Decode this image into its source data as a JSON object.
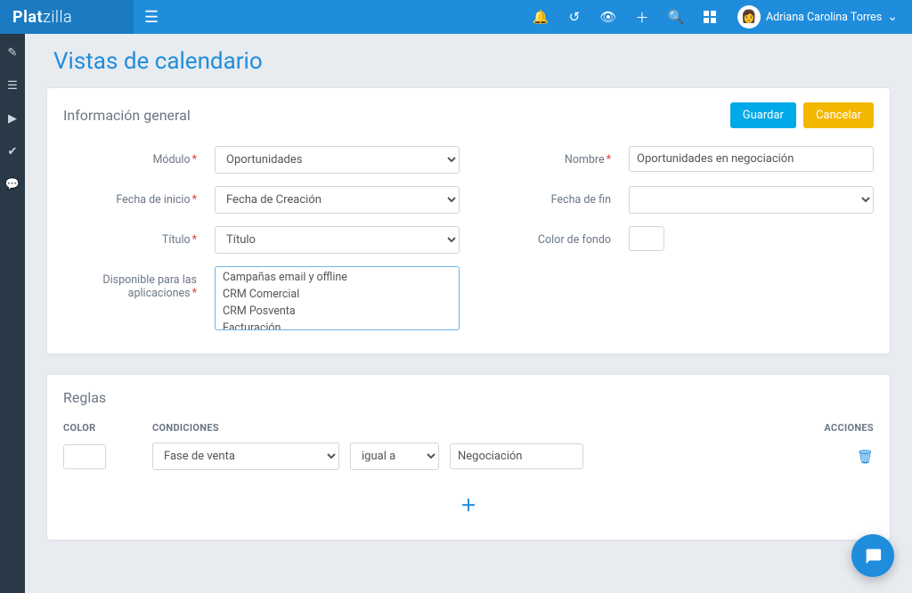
{
  "brand": {
    "a": "Plat",
    "b": "zilla"
  },
  "user": {
    "name": "Adriana Carolina Torres"
  },
  "page": {
    "title": "Vistas de calendario"
  },
  "buttons": {
    "save": "Guardar",
    "cancel": "Cancelar"
  },
  "panels": {
    "general": {
      "title": "Información general",
      "fields": {
        "module_label": "Módulo",
        "module_value": "Oportunidades",
        "name_label": "Nombre",
        "name_value": "Oportunidades en negociación",
        "startdate_label": "Fecha de inicio",
        "startdate_value": "Fecha de Creación",
        "enddate_label": "Fecha de fin",
        "enddate_value": "",
        "title_label": "Título",
        "title_value": "Título",
        "bgcolor_label": "Color de fondo",
        "apps_label": "Disponible para las aplicaciones",
        "app_options": [
          "Campañas email y offline",
          "CRM Comercial",
          "CRM Posventa",
          "Facturación"
        ]
      }
    },
    "rules": {
      "title": "Reglas",
      "headers": {
        "color": "COLOR",
        "cond": "CONDICIONES",
        "act": "ACCIONES"
      },
      "row": {
        "field": "Fase de venta",
        "op": "igual a",
        "value": "Negociación"
      }
    }
  }
}
